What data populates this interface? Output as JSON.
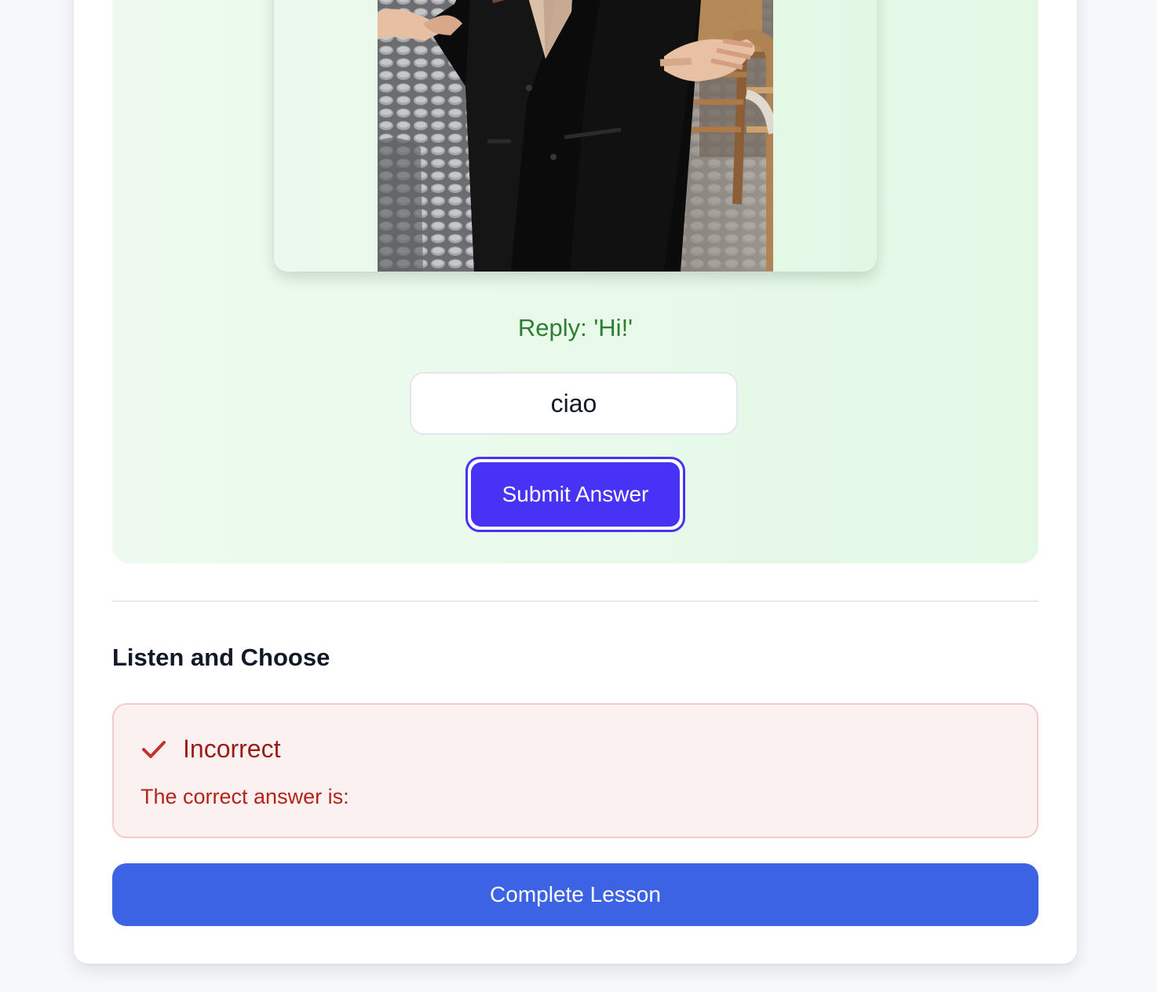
{
  "exercise": {
    "prompt": "Reply: 'Hi!'",
    "answer_value": "ciao",
    "submit_label": "Submit Answer",
    "image_icon": "person-photo"
  },
  "next_section": {
    "title": "Listen and Choose",
    "feedback_title": "Incorrect",
    "feedback_text": "The correct answer is:",
    "feedback_icon": "check-icon"
  },
  "actions": {
    "complete_label": "Complete Lesson"
  },
  "colors": {
    "page_bg": "#f6f8fb",
    "panel_green": "#e3f9e6",
    "accent_text": "#2e7d32",
    "submit_bg": "#4732f5",
    "error_bg": "#fcf1f1",
    "error_text": "#9a1c17",
    "complete_bg": "#3b63e4"
  }
}
